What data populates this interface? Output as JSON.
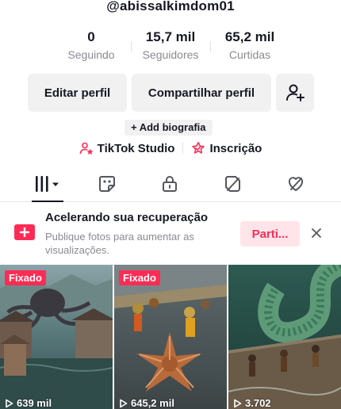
{
  "profile": {
    "username": "@abissalkimdom01"
  },
  "stats": [
    {
      "value": "0",
      "label": "Seguindo"
    },
    {
      "value": "15,7 mil",
      "label": "Seguidores"
    },
    {
      "value": "65,2 mil",
      "label": "Curtidas"
    }
  ],
  "actions": {
    "edit_label": "Editar perfil",
    "share_label": "Compartilhar perfil",
    "add_friend_icon": "add-user-icon"
  },
  "bio": {
    "add_label": "+ Add biografia"
  },
  "links": [
    {
      "label": "TikTok Studio",
      "icon": "studio-icon"
    },
    {
      "label": "Inscrição",
      "icon": "subscription-icon"
    }
  ],
  "tabs": [
    {
      "icon": "grid-icon",
      "active": true
    },
    {
      "icon": "sticker-icon"
    },
    {
      "icon": "lock-icon"
    },
    {
      "icon": "tag-icon"
    },
    {
      "icon": "heart-icon"
    }
  ],
  "promo": {
    "title": "Acelerando sua recuperação",
    "subtitle": "Publique fotos para aumentar as visualizações.",
    "button": "Parti...",
    "accent": "#fe2c55"
  },
  "videos": [
    {
      "pinned_label": "Fixado",
      "views": "639 mil",
      "theme": "flooded village with giant octopus"
    },
    {
      "pinned_label": "Fixado",
      "views": "645,2 mil",
      "theme": "giant starfish on ship deck with crew"
    },
    {
      "pinned_label": "",
      "views": "3.702",
      "theme": "giant sea serpent attacking boat"
    }
  ]
}
